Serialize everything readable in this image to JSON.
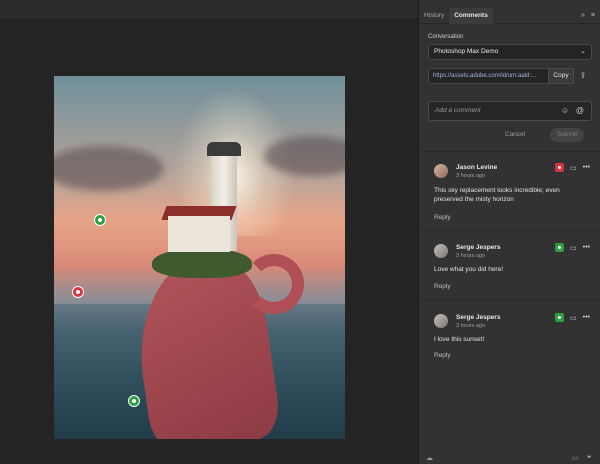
{
  "panel": {
    "tabs": [
      {
        "label": "History"
      },
      {
        "label": "Comments"
      }
    ],
    "menu_icons": [
      "chevrons-right-icon",
      "menu-icon"
    ],
    "conversation_label": "Conversation",
    "conversation_value": "Photoshop Max Demo",
    "share_url": "https://assets.adobe.com/id/urn:aaid:...",
    "copy_label": "Copy",
    "comment_placeholder": "Add a comment",
    "cancel_label": "Cancel",
    "submit_label": "Submit"
  },
  "comments": [
    {
      "author": "Jason Levine",
      "time": "3 hours ago",
      "text": "This sky replacement looks incredible; even preserved the misty horizon",
      "reply_label": "Reply",
      "pin_color": "#d7373f"
    },
    {
      "author": "Serge Jespers",
      "time": "3 hours ago",
      "text": "Love what you did here!",
      "reply_label": "Reply",
      "pin_color": "#2ea043"
    },
    {
      "author": "Serge Jespers",
      "time": "3 hours ago",
      "text": "I love this sunset!",
      "reply_label": "Reply",
      "pin_color": "#2ea043"
    }
  ],
  "colors": {
    "accent_green": "#2ea043",
    "accent_red": "#d7373f",
    "panel_bg": "#323232"
  }
}
